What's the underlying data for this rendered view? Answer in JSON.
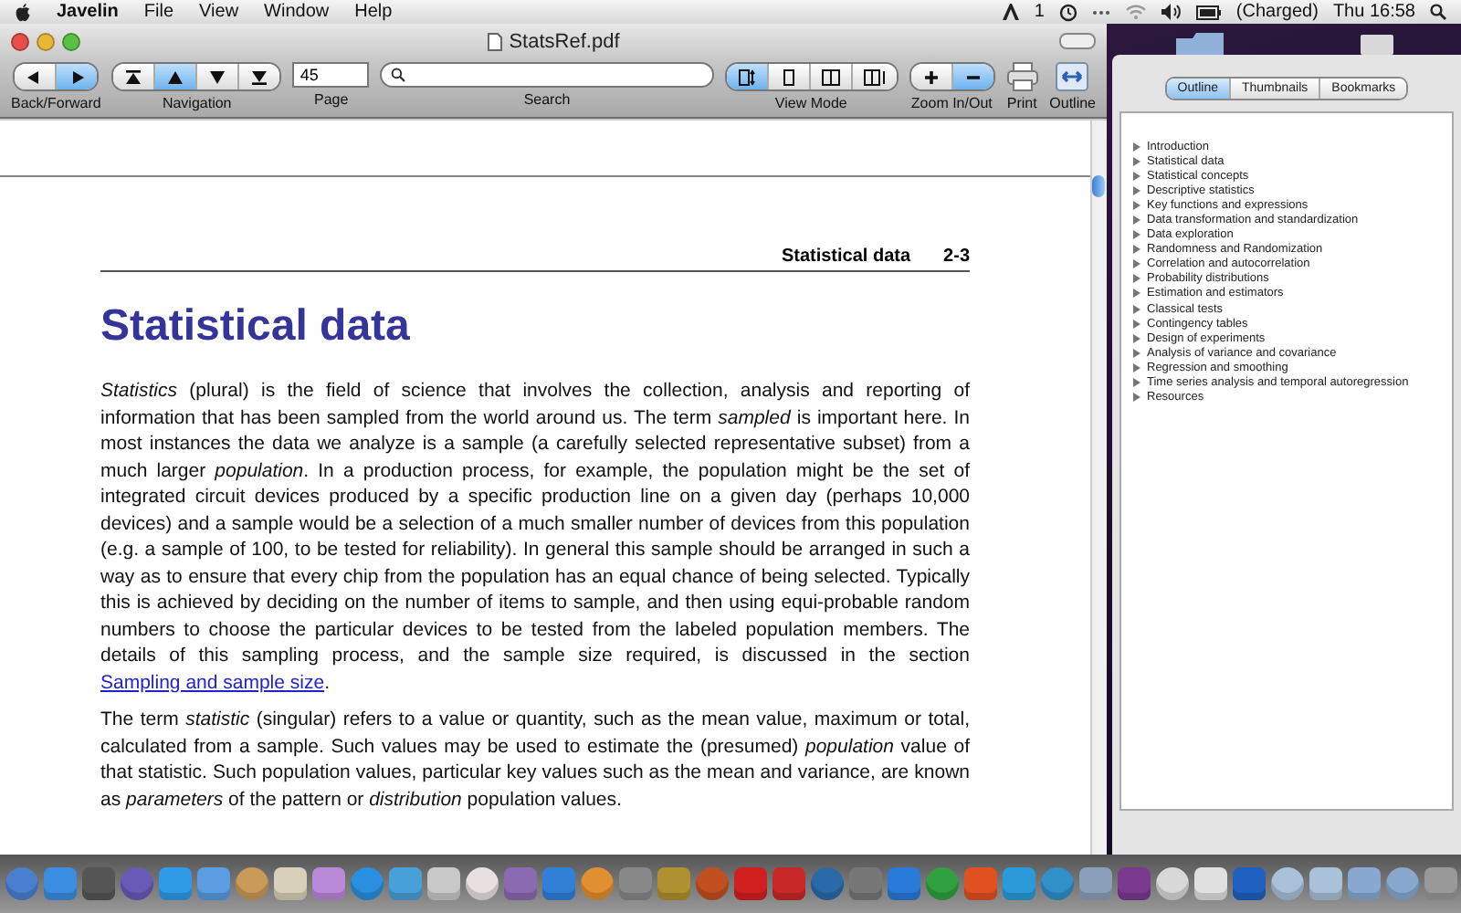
{
  "menu_bar": {
    "app": "Javelin",
    "items": [
      "File",
      "View",
      "Window",
      "Help"
    ],
    "status": {
      "adobe_count": "1",
      "battery": "(Charged)",
      "clock": "Thu 16:58"
    }
  },
  "window": {
    "title": "StatsRef.pdf"
  },
  "toolbar": [
    {
      "kind": "segmented",
      "label": "Back/Forward",
      "segments": [
        {
          "kind": "back",
          "selected": false
        },
        {
          "kind": "forward",
          "selected": true
        }
      ]
    },
    {
      "kind": "segmented",
      "label": "Navigation",
      "segments": [
        {
          "kind": "first",
          "selected": false
        },
        {
          "kind": "prev",
          "selected": true
        },
        {
          "kind": "next",
          "selected": false
        },
        {
          "kind": "last",
          "selected": false
        }
      ]
    },
    {
      "kind": "field",
      "label": "Page",
      "value": "45"
    },
    {
      "kind": "search",
      "label": "Search"
    },
    {
      "kind": "segmented",
      "label": "View Mode",
      "segments": [
        {
          "kind": "single-continuous",
          "selected": true
        },
        {
          "kind": "single",
          "selected": false
        },
        {
          "kind": "two-page",
          "selected": false
        },
        {
          "kind": "two-continuous",
          "selected": false
        }
      ]
    },
    {
      "kind": "segmented",
      "label": "Zoom In/Out",
      "segments": [
        {
          "kind": "zoom-in",
          "selected": false
        },
        {
          "kind": "zoom-out",
          "selected": true
        }
      ]
    },
    {
      "kind": "print",
      "label": "Print"
    },
    {
      "kind": "outline",
      "label": "Outline"
    }
  ],
  "document": {
    "running_header": "Statistical data",
    "page_number": "2-3",
    "heading": "Statistical data",
    "paragraphs": [
      {
        "before": "*Statistics* (plural) is the field of science that involves the collection, analysis and reporting of information that has been sampled from the world around us. The term *sampled* is important here. In most instances the data we analyze is a sample (a carefully selected representative subset) from a much larger *population*. In a production process, for example, the population might be the set of integrated circuit devices produced by a specific production line on a given day (perhaps 10,000 devices) and a sample would be a selection of a much smaller number of devices from this population (e.g. a sample of 100, to be tested for reliability). In general this sample should be arranged in such a way as to ensure that every chip from the population has an equal chance of being selected. Typically this is achieved by deciding on the number of items to sample, and then using equi-probable random numbers to choose the particular devices to be tested from the labeled population members. The details of this sampling process, and the sample size required, is discussed in the section ",
        "link": "Sampling and sample size",
        "after": "."
      },
      {
        "before": "The term *statistic* (singular) refers to a value or quantity, such as the mean value, maximum or total, calculated from a sample. Such values may be used to estimate the (presumed) *population* value of that statistic. Such population values, particular key values such as the mean and variance, are known as *parameters* of the pattern or *distribution* population values."
      }
    ]
  },
  "drawer": {
    "tabs": [
      {
        "label": "Outline",
        "selected": true
      },
      {
        "label": "Thumbnails",
        "selected": false
      },
      {
        "label": "Bookmarks",
        "selected": false
      }
    ],
    "outline": [
      {
        "label": "Introduction",
        "expanded": false
      },
      {
        "label": "Statistical data",
        "expanded": false
      },
      {
        "label": "Statistical concepts",
        "expanded": false
      },
      {
        "label": "Descriptive statistics",
        "expanded": false
      },
      {
        "label": "Key functions and expressions",
        "expanded": false
      },
      {
        "label": "Data transformation and standardization",
        "expanded": false
      },
      {
        "label": "Data exploration",
        "expanded": false
      },
      {
        "label": "Randomness and Randomization",
        "expanded": false
      },
      {
        "label": "Correlation and autocorrelation",
        "expanded": false
      },
      {
        "label": "Probability distributions",
        "expanded": false
      },
      {
        "label": "Estimation and estimators",
        "expanded": false
      },
      {
        "label": "Classical tests",
        "expanded": false
      },
      {
        "label": "Contingency tables",
        "expanded": false
      },
      {
        "label": "Design of experiments",
        "expanded": false
      },
      {
        "label": "Analysis of variance and covariance",
        "expanded": false
      },
      {
        "label": "Regression and smoothing",
        "expanded": false
      },
      {
        "label": "Time series analysis and temporal autoregression",
        "expanded": false
      },
      {
        "label": "Resources",
        "expanded": false
      }
    ]
  }
}
